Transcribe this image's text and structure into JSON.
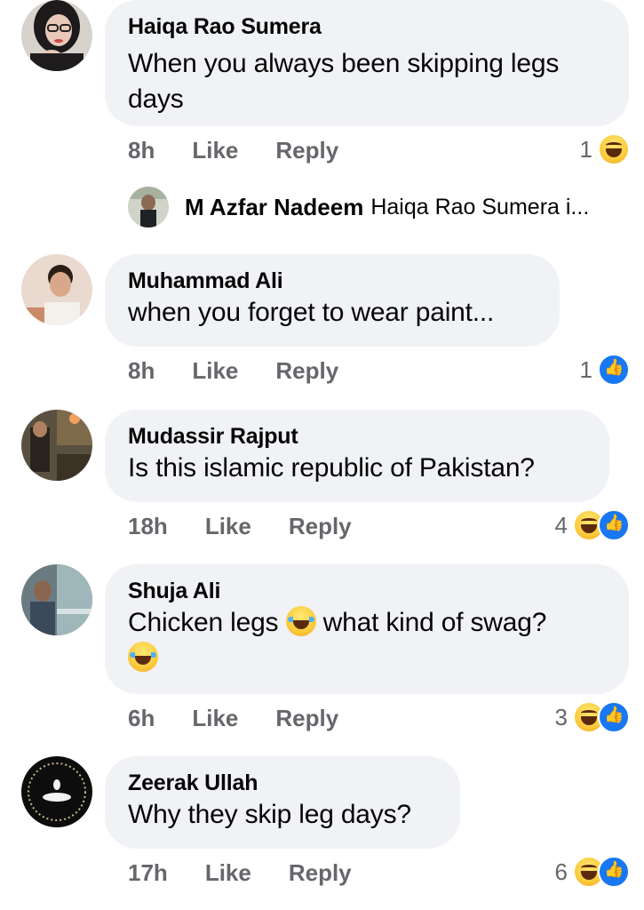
{
  "comments": [
    {
      "name": "Haiqa  Rao Sumera",
      "text": "When you always been skipping legs days",
      "time": "8h",
      "like": "Like",
      "reply": "Reply",
      "react_count": "1",
      "reactions": [
        "haha"
      ]
    },
    {
      "name": "Muhammad Ali",
      "text": "when you forget to wear paint...",
      "time": "8h",
      "like": "Like",
      "reply": "Reply",
      "react_count": "1",
      "reactions": [
        "like"
      ]
    },
    {
      "name": "Mudassir Rajput",
      "text": "Is this islamic republic of Pakistan?",
      "time": "18h",
      "like": "Like",
      "reply": "Reply",
      "react_count": "4",
      "reactions": [
        "haha",
        "like"
      ]
    },
    {
      "name": "Shuja Ali",
      "text_part1": "Chicken legs",
      "text_part2": "what kind of swag?",
      "time": "6h",
      "like": "Like",
      "reply": "Reply",
      "react_count": "3",
      "reactions": [
        "haha",
        "like"
      ]
    },
    {
      "name": "Zeerak Ullah",
      "text": "Why they skip leg days?",
      "time": "17h",
      "like": "Like",
      "reply": "Reply",
      "react_count": "6",
      "reactions": [
        "haha",
        "like"
      ]
    }
  ],
  "reply_preview": {
    "name": "M Azfar Nadeem",
    "text": "Haiqa  Rao Sumera i..."
  },
  "colors": {
    "bubble": "#f0f2f5",
    "meta_text": "#65676b",
    "like_blue": "#1877f2"
  }
}
